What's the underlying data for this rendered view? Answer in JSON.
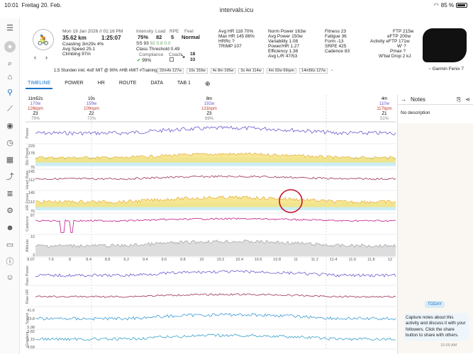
{
  "status_bar": {
    "time": "10:01",
    "date": "Freitag 20. Feb.",
    "url": "intervals.icu",
    "battery": "85 %"
  },
  "activity": {
    "date": "Mon 19 Jan 2026 // 01:16 PM",
    "distance": "35.62 km",
    "duration": "1:25:07",
    "coasting": "Coasting 3m29s 4%",
    "avg_speed": "Avg Speed 25.1",
    "climbing": "Climbing 97m",
    "intensity_label": "Intensity",
    "intensity": "75%",
    "load_label": "Load",
    "load": "82",
    "rpe_label": "RPE",
    "rpe": "5",
    "feel_label": "Feel",
    "feel": "Normal",
    "ss": "SS 93",
    "ss_split": "92  0.8  0.0",
    "class": "Class Threshold 0.49",
    "compliance_label": "Compliance",
    "compliance": "99%",
    "coach_label": "Coach",
    "ratio_a": "18",
    "ratio_b": "33",
    "avg_hr": "Avg HR 118 70%",
    "max_hr": "Max HR 145 86%",
    "hrrc": "HRRc ?",
    "trimp": "TRIMP 107",
    "norm_power": "Norm Power 163w",
    "avg_power": "Avg Power 150w",
    "variability": "Variability 1.08",
    "power_hr": "Power/HR 1.27",
    "efficiency": "Efficiency 1.38",
    "avg_lr": "Avg L/R 47/53",
    "fitness": "Fitness 23",
    "fatigue": "Fatigue 36",
    "form": "Form -13",
    "srpe": "SRPE 425",
    "cadence": "Cadence 83",
    "ftp": "FTP 215w",
    "eftp": "eFTP 200w",
    "activity_eftp": "Activity eFTP 171w",
    "wprime": "W' ?",
    "pmax": "Pmax ?",
    "wbal": "W'bal Drop 2 kJ",
    "device": "~ Garmin Fenix 7",
    "description": "1,5 Stunden inkl. 4x8' MIT @ 90% #HB #MIT #Training",
    "interval_chips": [
      "22m4s 127w",
      "10s 159w",
      "4x 8m 195w",
      "3x 4m 114w",
      "4m 92w 69rpm",
      "14m56s 127w"
    ]
  },
  "tabs": [
    "TIMELINE",
    "POWER",
    "HR",
    "ROUTE",
    "DATA",
    "TAB 1"
  ],
  "interval_summary": [
    {
      "t": "11m52s",
      "w": "170w",
      "bpm": "126bpm",
      "z": "Z3",
      "pct": "79%"
    },
    {
      "t": "10s",
      "w": "159w",
      "bpm": "109bpm",
      "z": "Z2",
      "pct": "73%"
    },
    {
      "t": "8m",
      "w": "192w",
      "bpm": "131bpm",
      "z": "Z3",
      "pct": "89%"
    },
    {
      "t": "4m",
      "w": "110w",
      "bpm": "117bpm",
      "z": "Z1",
      "pct": "51%"
    }
  ],
  "chart_rows": [
    "Power",
    "30s Power",
    "Heart Rate",
    "HR Zones",
    "Cadence",
    "Altitude",
    "Raw Power",
    "Raw HR",
    "Speed",
    "Gradient"
  ],
  "y_ticks": {
    "power": [
      "",
      ""
    ],
    "p30": [
      "229",
      "178",
      "",
      "76"
    ],
    "hr": [
      "145",
      "112",
      ""
    ],
    "hrz": [
      "145",
      "112",
      "76"
    ],
    "cad": [
      "87",
      ""
    ],
    "alt": [
      "10",
      "3"
    ],
    "rawpower": [
      "",
      ""
    ],
    "rawhr": [
      "",
      ""
    ],
    "speed": [
      "41.6",
      "23.8",
      "5.98"
    ],
    "grad": [
      "3.82",
      "1.15",
      "-4.59"
    ]
  },
  "y_misc": {
    "alt_top": "8.07"
  },
  "x_ticks": [
    "7.6",
    "8",
    "8.4",
    "8.8",
    "9.2",
    "9.4",
    "9.6",
    "9.8",
    "10",
    "10.2",
    "10.4",
    "10.6",
    "10.8",
    "11",
    "11.2",
    "11.4",
    "11.6",
    "11.8",
    "12"
  ],
  "notes": {
    "title": "Notes",
    "no_description": "No description",
    "today": "TODAY",
    "message": "Capture notes about this activity and discuss it with your followers. Click the share button to share with others.",
    "time": "10:00 AM"
  },
  "colors": {
    "accent": "#1a73c9",
    "power": "#6a5acd",
    "hr": "#9b3057",
    "zone_yellow": "#f6e48a",
    "zone_green": "#a8e0a0",
    "cadence": "#c01885",
    "speed": "#3a9ad6"
  }
}
